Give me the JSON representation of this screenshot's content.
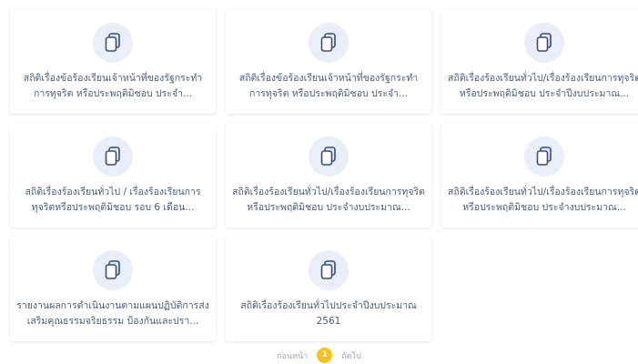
{
  "cards": [
    {
      "title": "สถิติเรื่องข้อร้องเรียนเจ้าหน้าที่ของรัฐกระทำการทุจริต หรือประพฤติมิชอบ ประจำ...",
      "icon": "document-icon"
    },
    {
      "title": "สถิติเรื่องข้อร้องเรียนเจ้าหน้าที่ของรัฐกระทำการทุจริต หรือประพฤติมิชอบ ประจำ...",
      "icon": "document-icon"
    },
    {
      "title": "สถิติเรื่องร้องเรียนทั่วไป/เรื่องร้องเรียนการทุจริตหรือประพฤติมิชอบ ประจำปีงบประมาณ...",
      "icon": "document-icon"
    },
    {
      "title": "สถิติเรื่องร้องเรียนทั่วไป / เรื่องร้องเรียนการทุจริตหรือประพฤติมิชอบ รอบ 6 เดือน...",
      "icon": "document-icon"
    },
    {
      "title": "สถิติเรื่องร้องเรียนทั่วไป/เรื่องร้องเรียนการทุจริตหรือประพฤติมิชอบ ประจำงบประมาณ...",
      "icon": "document-icon"
    },
    {
      "title": "สถิติเรื่องร้องเรียนทั่วไป/เรื่องร้องเรียนการทุจริตหรือประพฤติมิชอบ ประจำงบประมาณ...",
      "icon": "document-icon"
    },
    {
      "title": "รายงานผลการดำเนินงานตามแผนปฏิบัติการส่งเสริมคุณธรรมจริยธรรม ป้องกันและปรา...",
      "icon": "document-icon"
    },
    {
      "title": "สถิติเรื่องร้องเรียนทั่วไปประจำปีงบประมาณ 2561",
      "icon": "document-icon"
    }
  ],
  "pagination": {
    "prev_label": "ก่อนหน้า",
    "current_page": "1",
    "next_label": "ถัดไป"
  },
  "colors": {
    "accent": "#f6c21b",
    "icon_bg": "#e9eef8",
    "icon_stroke": "#3a4c7a",
    "text": "#4a5a7a"
  }
}
